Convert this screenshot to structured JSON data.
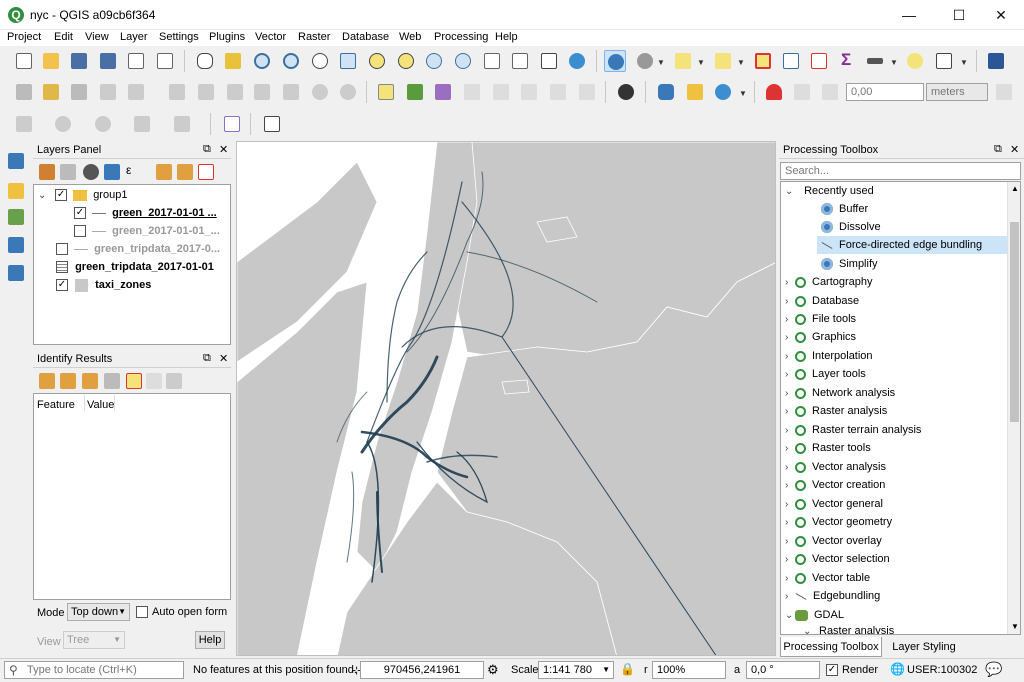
{
  "app": {
    "title": "nyc - QGIS a09cb6f364",
    "logo_icon": "qgis-logo-icon",
    "controls": {
      "minimize": "—",
      "maximize": "☐",
      "close": "✕"
    }
  },
  "menu": [
    "Project",
    "Edit",
    "View",
    "Layer",
    "Settings",
    "Plugins",
    "Vector",
    "Raster",
    "Database",
    "Web",
    "Processing",
    "Help"
  ],
  "toolbar2": {
    "value_field": "0,00",
    "units": "meters"
  },
  "layers_panel": {
    "title": "Layers Panel",
    "items": [
      {
        "label": "group1",
        "checked": true,
        "style": "normal"
      },
      {
        "label": "green_2017-01-01 ...",
        "checked": true,
        "style": "bold-underline"
      },
      {
        "label": "green_2017-01-01_...",
        "checked": false,
        "style": "gray"
      },
      {
        "label": "green_tripdata_2017-0...",
        "checked": false,
        "style": "gray"
      },
      {
        "label": "green_tripdata_2017-01-01",
        "checked": false,
        "style": "bold"
      },
      {
        "label": "taxi_zones",
        "checked": true,
        "style": "bold"
      }
    ]
  },
  "identify_panel": {
    "title": "Identify Results",
    "col_feature": "Feature",
    "col_value": "Value",
    "mode_label": "Mode",
    "mode_value": "Top down",
    "auto_open_label": "Auto open form",
    "view_label": "View",
    "view_value": "Tree",
    "help_label": "Help"
  },
  "processing": {
    "title": "Processing Toolbox",
    "search_placeholder": "Search...",
    "recent_header": "Recently used",
    "recent": [
      "Buffer",
      "Dissolve",
      "Force-directed edge bundling",
      "Simplify"
    ],
    "groups": [
      "Cartography",
      "Database",
      "File tools",
      "Graphics",
      "Interpolation",
      "Layer tools",
      "Network analysis",
      "Raster analysis",
      "Raster terrain analysis",
      "Raster tools",
      "Vector analysis",
      "Vector creation",
      "Vector general",
      "Vector geometry",
      "Vector overlay",
      "Vector selection",
      "Vector table",
      "Edgebundling",
      "GDAL"
    ],
    "gdal_sub": "Raster analysis",
    "tabs": [
      "Processing Toolbox",
      "Layer Styling"
    ]
  },
  "status": {
    "locate_placeholder": "Type to locate (Ctrl+K)",
    "message": "No features at this position found.",
    "coord_label": "⊹",
    "coordinate": "970456,241961",
    "scale_label": "Scale",
    "scale_value": "1:141 780",
    "mag_label": "r",
    "magnifier": "100%",
    "rot_label": "a",
    "rotation": "0,0 °",
    "render_label": "Render",
    "crs": "USER:100302"
  },
  "colors": {
    "map_bg": "#ffffff",
    "land": "#c8c8c8",
    "edges": "#1d3b4f",
    "highlight": "#cce4f7"
  }
}
